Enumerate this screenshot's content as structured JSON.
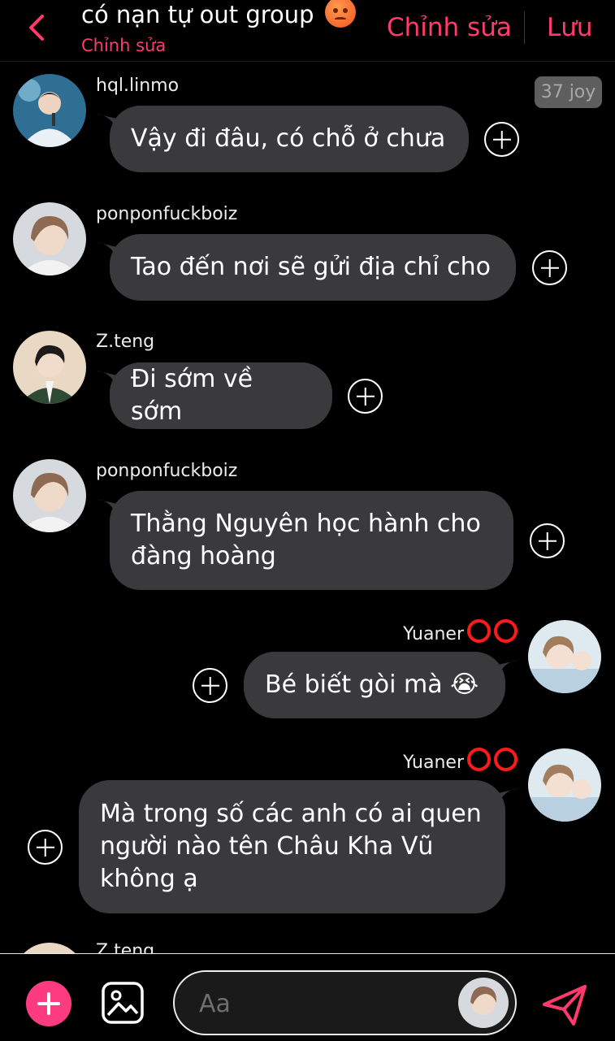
{
  "header": {
    "title": "có nạn tự out group",
    "title_emoji": "angry-face-emoji",
    "subtitle": "Chỉnh sửa",
    "edit_label": "Chỉnh sửa",
    "save_label": "Lưu",
    "accent_color": "#ff3b6b"
  },
  "badge": "37 joy",
  "messages": [
    {
      "sender": "hql.linmo",
      "text": "Vậy đi đâu, có chỗ ở chưa",
      "side": "left"
    },
    {
      "sender": "ponponfuckboiz",
      "text": "Tao đến nơi sẽ gửi địa chỉ cho",
      "side": "left"
    },
    {
      "sender": "Z.teng",
      "text": "Đi sớm về sớm",
      "side": "left"
    },
    {
      "sender": "ponponfuckboiz",
      "text": "Thằng Nguyên học hành cho\nđàng hoàng",
      "side": "left"
    },
    {
      "sender": "Yuaner",
      "text": "Bé biết gòi mà 😭",
      "side": "right"
    },
    {
      "sender": "Yuaner",
      "text": "Mà trong số các anh có ai quen\nngười nào tên Châu Kha Vũ\nkhông ạ",
      "side": "right"
    },
    {
      "sender": "Z.teng",
      "text": "",
      "side": "left"
    }
  ],
  "composer": {
    "placeholder": "Aa",
    "add_icon": "plus-icon",
    "gallery_icon": "image-icon",
    "send_icon": "send-icon"
  }
}
